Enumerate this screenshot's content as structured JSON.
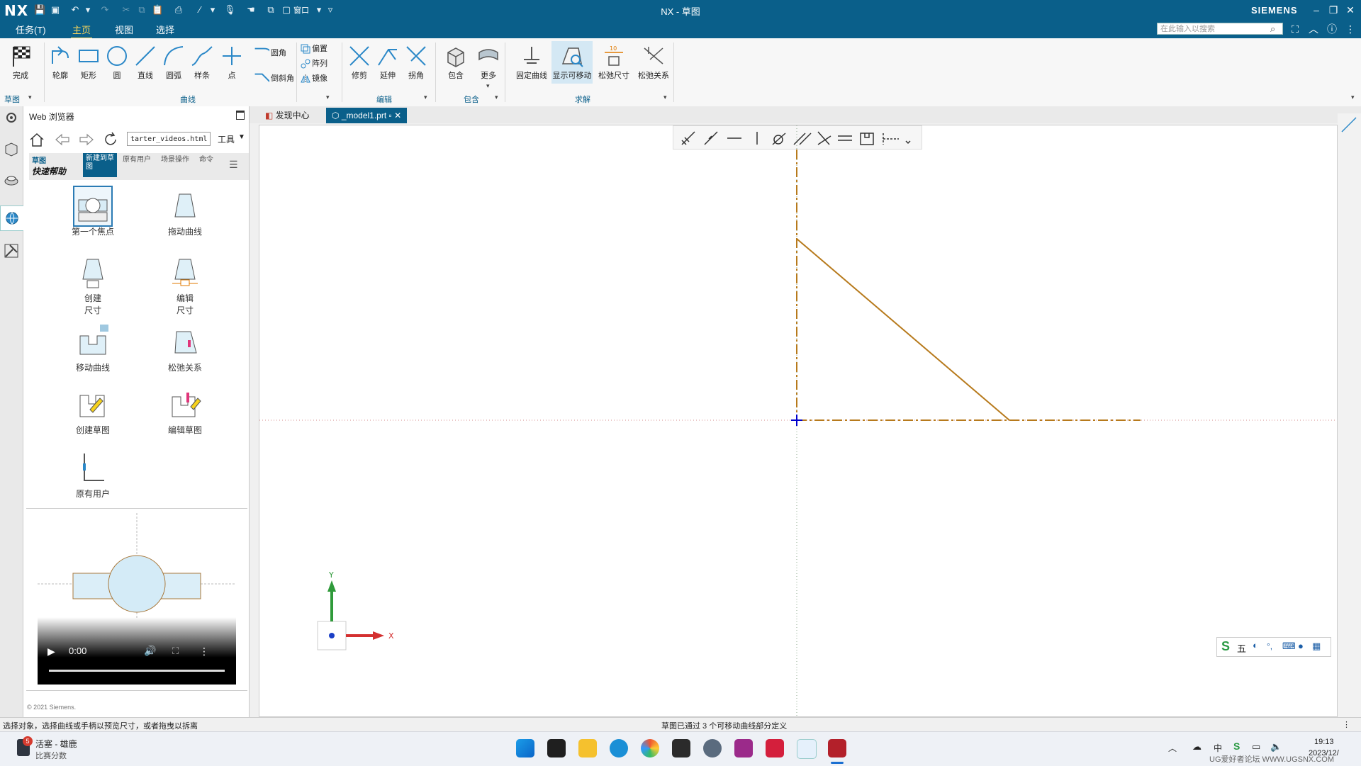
{
  "titlebar": {
    "app_logo": "NX",
    "title": "NX - 草图",
    "brand": "SIEMENS"
  },
  "quickaccess": {
    "window_label": "窗口"
  },
  "menubar": {
    "items": [
      "任务(T)",
      "主页",
      "视图",
      "选择"
    ],
    "search_placeholder": "在此输入以搜索"
  },
  "ribbon": {
    "finish_label": "完成",
    "sketch_group_label": "草图",
    "curve_tools": [
      "轮廓",
      "矩形",
      "圆",
      "直线",
      "圆弧",
      "样条",
      "点"
    ],
    "corner_tools": [
      "圆角",
      "倒斜角"
    ],
    "small_tools": [
      "偏置",
      "阵列",
      "镜像"
    ],
    "curve_group_label": "曲线",
    "edit_tools": [
      "修剪",
      "延伸",
      "拐角"
    ],
    "edit_group_label": "编辑",
    "include_tools": [
      "包含",
      "更多"
    ],
    "include_group_label": "包含",
    "solve_tools": [
      "固定曲线",
      "显示可移动",
      "松弛尺寸",
      "松弛关系"
    ],
    "solve_group_label": "求解",
    "dimension_badge": "10"
  },
  "panel": {
    "title": "Web 浏览器",
    "address": "tarter_videos.html",
    "tools_label": "工具",
    "brand_top": "草图",
    "brand_bottom": "快速帮助",
    "tabs": [
      "新建到草图",
      "原有用户",
      "场景操作",
      "命令"
    ],
    "gallery": [
      "第一个焦点",
      "拖动曲线",
      "创建尺寸",
      "编辑尺寸",
      "移动曲线",
      "松弛关系",
      "创建草图",
      "编辑草图",
      "原有用户"
    ],
    "video_time": "0:00",
    "copyright": "© 2021 Siemens."
  },
  "doctabs": {
    "items": [
      "发现中心",
      "_model1.prt"
    ]
  },
  "canvas": {
    "axis_y": "Y",
    "axis_x": "X"
  },
  "ime": {
    "items": [
      "五"
    ]
  },
  "status": {
    "left": "选择对象，选择曲线或手柄以预览尺寸，或者拖曳以拆离",
    "center": "草图已通过 3 个可移动曲线部分定义"
  },
  "taskbar": {
    "notif_count": "5",
    "widget_title": "活塞 - 雄鹿",
    "widget_sub": "比赛分数",
    "time": "19:13",
    "date": "2023/12/",
    "ime_label": "中",
    "watermark": "UG爱好者论坛 WWW.UGSNX.COM"
  },
  "colors": {
    "accent": "#0a5f8a",
    "highlight_tab": "#ffd85a",
    "sketch_curve": "#b77a1c",
    "axis_y": "#2f9a3a",
    "axis_x": "#d43030"
  }
}
